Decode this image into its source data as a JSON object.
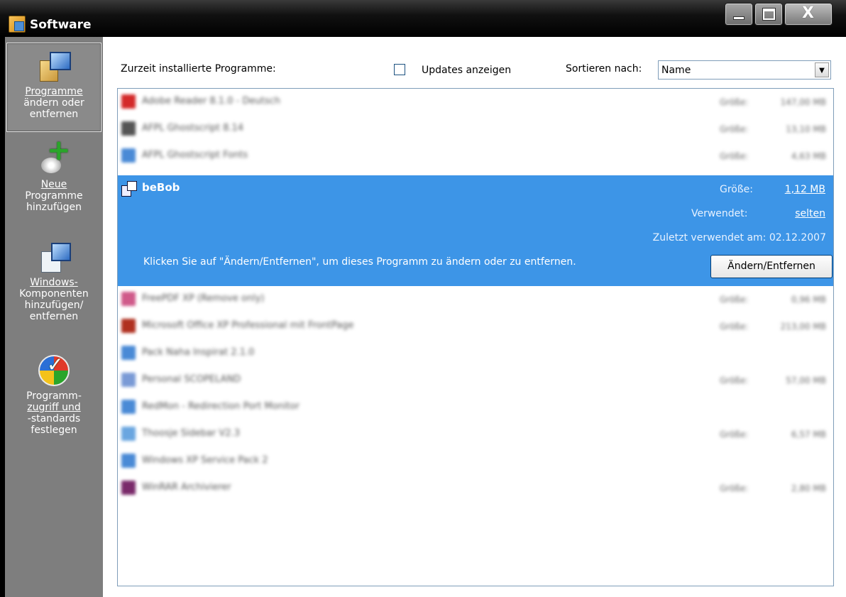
{
  "window": {
    "title": "Software",
    "controls": {
      "minimize": "",
      "maximize": "",
      "close": "X"
    }
  },
  "sidebar": {
    "items": [
      {
        "label_line1": "Programme",
        "label_line2": "ändern oder",
        "label_line3": "entfernen",
        "icon": "programs-icon",
        "selected": true
      },
      {
        "label_line1": "Neue",
        "label_line2": "Programme",
        "label_line3": "hinzufügen",
        "icon": "add-program-icon",
        "selected": false
      },
      {
        "label_line1": "Windows-",
        "label_line2": "Komponenten",
        "label_line3": "hinzufügen/",
        "label_line4": "entfernen",
        "icon": "windows-components-icon",
        "selected": false
      },
      {
        "label_line1": "Programm-",
        "label_line2": "zugriff und",
        "label_line3": "-standards",
        "label_line4": "festlegen",
        "icon": "program-access-icon",
        "selected": false
      }
    ]
  },
  "header": {
    "installed_label": "Zurzeit installierte Programme:",
    "updates_label": "Updates anzeigen",
    "updates_checked": false,
    "sort_label": "Sortieren nach:",
    "sort_value": "Name"
  },
  "programs": [
    {
      "name": "Adobe Reader 8.1.0 - Deutsch",
      "size_label": "Größe:",
      "size": "147,00 MB",
      "icon_color": "#d42a2a"
    },
    {
      "name": "AFPL Ghostscript 8.14",
      "size_label": "Größe:",
      "size": "13,10 MB",
      "icon_color": "#555555"
    },
    {
      "name": "AFPL Ghostscript Fonts",
      "size_label": "Größe:",
      "size": "4,63 MB",
      "icon_color": "#4a8ad6"
    },
    {
      "name": "FreePDF XP (Remove only)",
      "size_label": "Größe:",
      "size": "0,96 MB",
      "icon_color": "#d05a8a"
    },
    {
      "name": "Microsoft Office XP Professional mit FrontPage",
      "size_label": "Größe:",
      "size": "213,00 MB",
      "icon_color": "#b03020"
    },
    {
      "name": "Pack Naha Inspirat 2.1.0",
      "size_label": "",
      "size": "",
      "icon_color": "#4a8ad6"
    },
    {
      "name": "Personal SCOPELAND",
      "size_label": "Größe:",
      "size": "57,00 MB",
      "icon_color": "#7a9ad6"
    },
    {
      "name": "RedMon - Redirection Port Monitor",
      "size_label": "",
      "size": "",
      "icon_color": "#4a8ad6"
    },
    {
      "name": "Thoosje Sidebar V2.3",
      "size_label": "Größe:",
      "size": "6,57 MB",
      "icon_color": "#6aa6e0"
    },
    {
      "name": "Windows XP Service Pack 2",
      "size_label": "",
      "size": "",
      "icon_color": "#4a8ad6"
    },
    {
      "name": "WinRAR Archivierer",
      "size_label": "Größe:",
      "size": "2,80 MB",
      "icon_color": "#7a2a6a"
    }
  ],
  "selected_program": {
    "name": "beBob",
    "size_label": "Größe:",
    "size": "1,12 MB",
    "used_label": "Verwendet:",
    "used_value": "selten",
    "last_used": "Zuletzt verwendet am: 02.12.2007",
    "hint": "Klicken Sie auf \"Ändern/Entfernen\", um dieses Programm zu ändern oder zu entfernen.",
    "button_label": "Ändern/Entfernen"
  },
  "colors": {
    "selection": "#3d95e7",
    "sidebar": "#7e7e7e"
  }
}
